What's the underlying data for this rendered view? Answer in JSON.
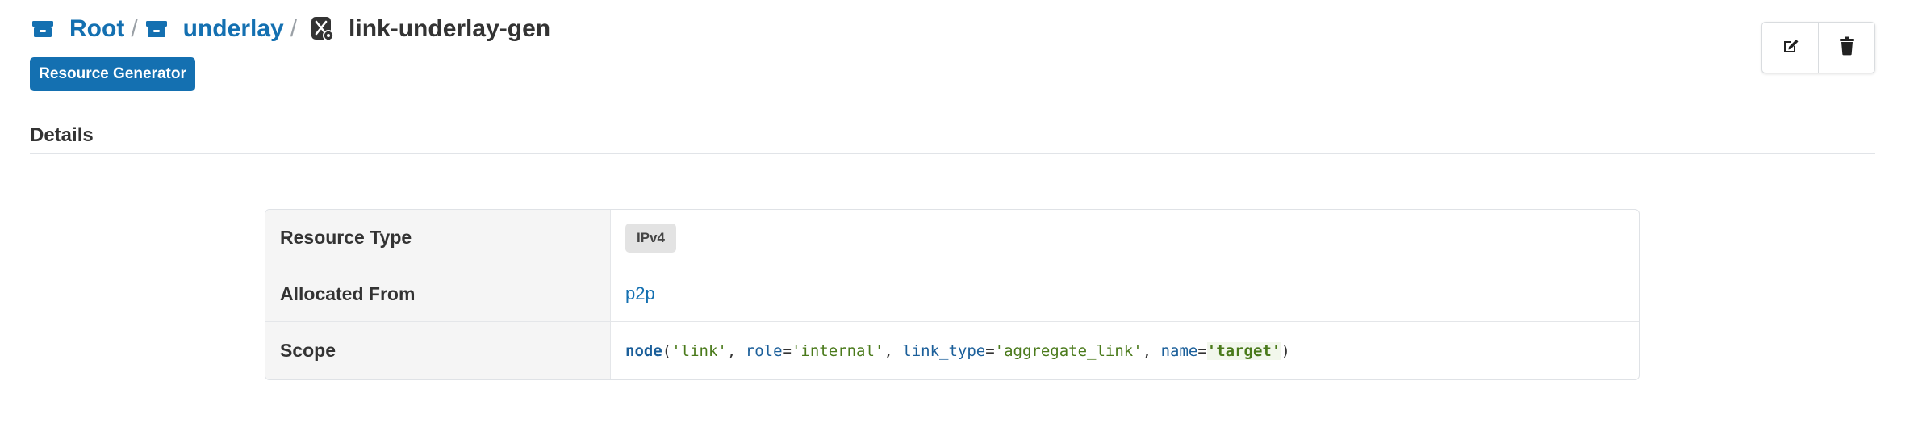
{
  "breadcrumb": {
    "root_label": "Root",
    "separator": "/",
    "parent_label": "underlay",
    "current_label": "link-underlay-gen"
  },
  "type_badge": "Resource Generator",
  "actions": {
    "edit_icon": "edit-icon",
    "delete_icon": "trash-icon"
  },
  "section": {
    "title": "Details"
  },
  "details": {
    "rows": [
      {
        "label": "Resource Type",
        "value": "IPv4"
      },
      {
        "label": "Allocated From",
        "value": "p2p"
      },
      {
        "label": "Scope"
      }
    ],
    "scope_expression": {
      "fn": "node",
      "open": "(",
      "arg1": "'link'",
      "comma1": ", ",
      "key2": "role",
      "eq2": "=",
      "val2": "'internal'",
      "comma2": ", ",
      "key3": "link_type",
      "eq3": "=",
      "val3": "'aggregate_link'",
      "comma3": ", ",
      "key4": "name",
      "eq4": "=",
      "val4": "'target'",
      "close": ")"
    }
  },
  "colors": {
    "accent": "#1470b1",
    "code_string": "#4a7a1b",
    "code_keyword": "#1b5f9a"
  }
}
